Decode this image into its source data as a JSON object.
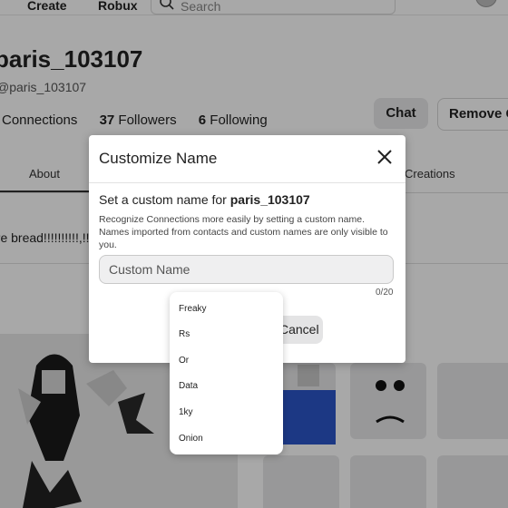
{
  "nav": {
    "create_label": "Create",
    "robux_label": "Robux",
    "search_placeholder": "Search"
  },
  "profile": {
    "display_name": "paris_103107",
    "handle": "@paris_103107",
    "stats": {
      "connections_label": "Connections",
      "followers_count": "37",
      "followers_label": "Followers",
      "following_count": "6",
      "following_label": "Following"
    },
    "chat_label": "Chat",
    "remove_label": "Remove Connection",
    "bio": "are bread!!!!!!!!!!,!!,,!!!,,,"
  },
  "tabs": [
    {
      "label": "About"
    },
    {
      "label": "Creations"
    }
  ],
  "modal": {
    "title": "Customize Name",
    "heading_prefix": "Set a custom name for",
    "heading_user": "paris_103107",
    "description": "Recognize Connections more easily by setting a custom name. Names imported from contacts and custom names are only visible to you.",
    "input_placeholder": "Custom Name",
    "input_value": "",
    "char_count": "0/20",
    "cancel_label": "Cancel"
  },
  "suggestions": [
    "Freaky",
    "Rs",
    "Or",
    "Data",
    "1ky",
    "Onion"
  ],
  "colors": {
    "overlay": "#000000",
    "modal_bg": "#ffffff",
    "button_bg": "#e4e4e5"
  }
}
